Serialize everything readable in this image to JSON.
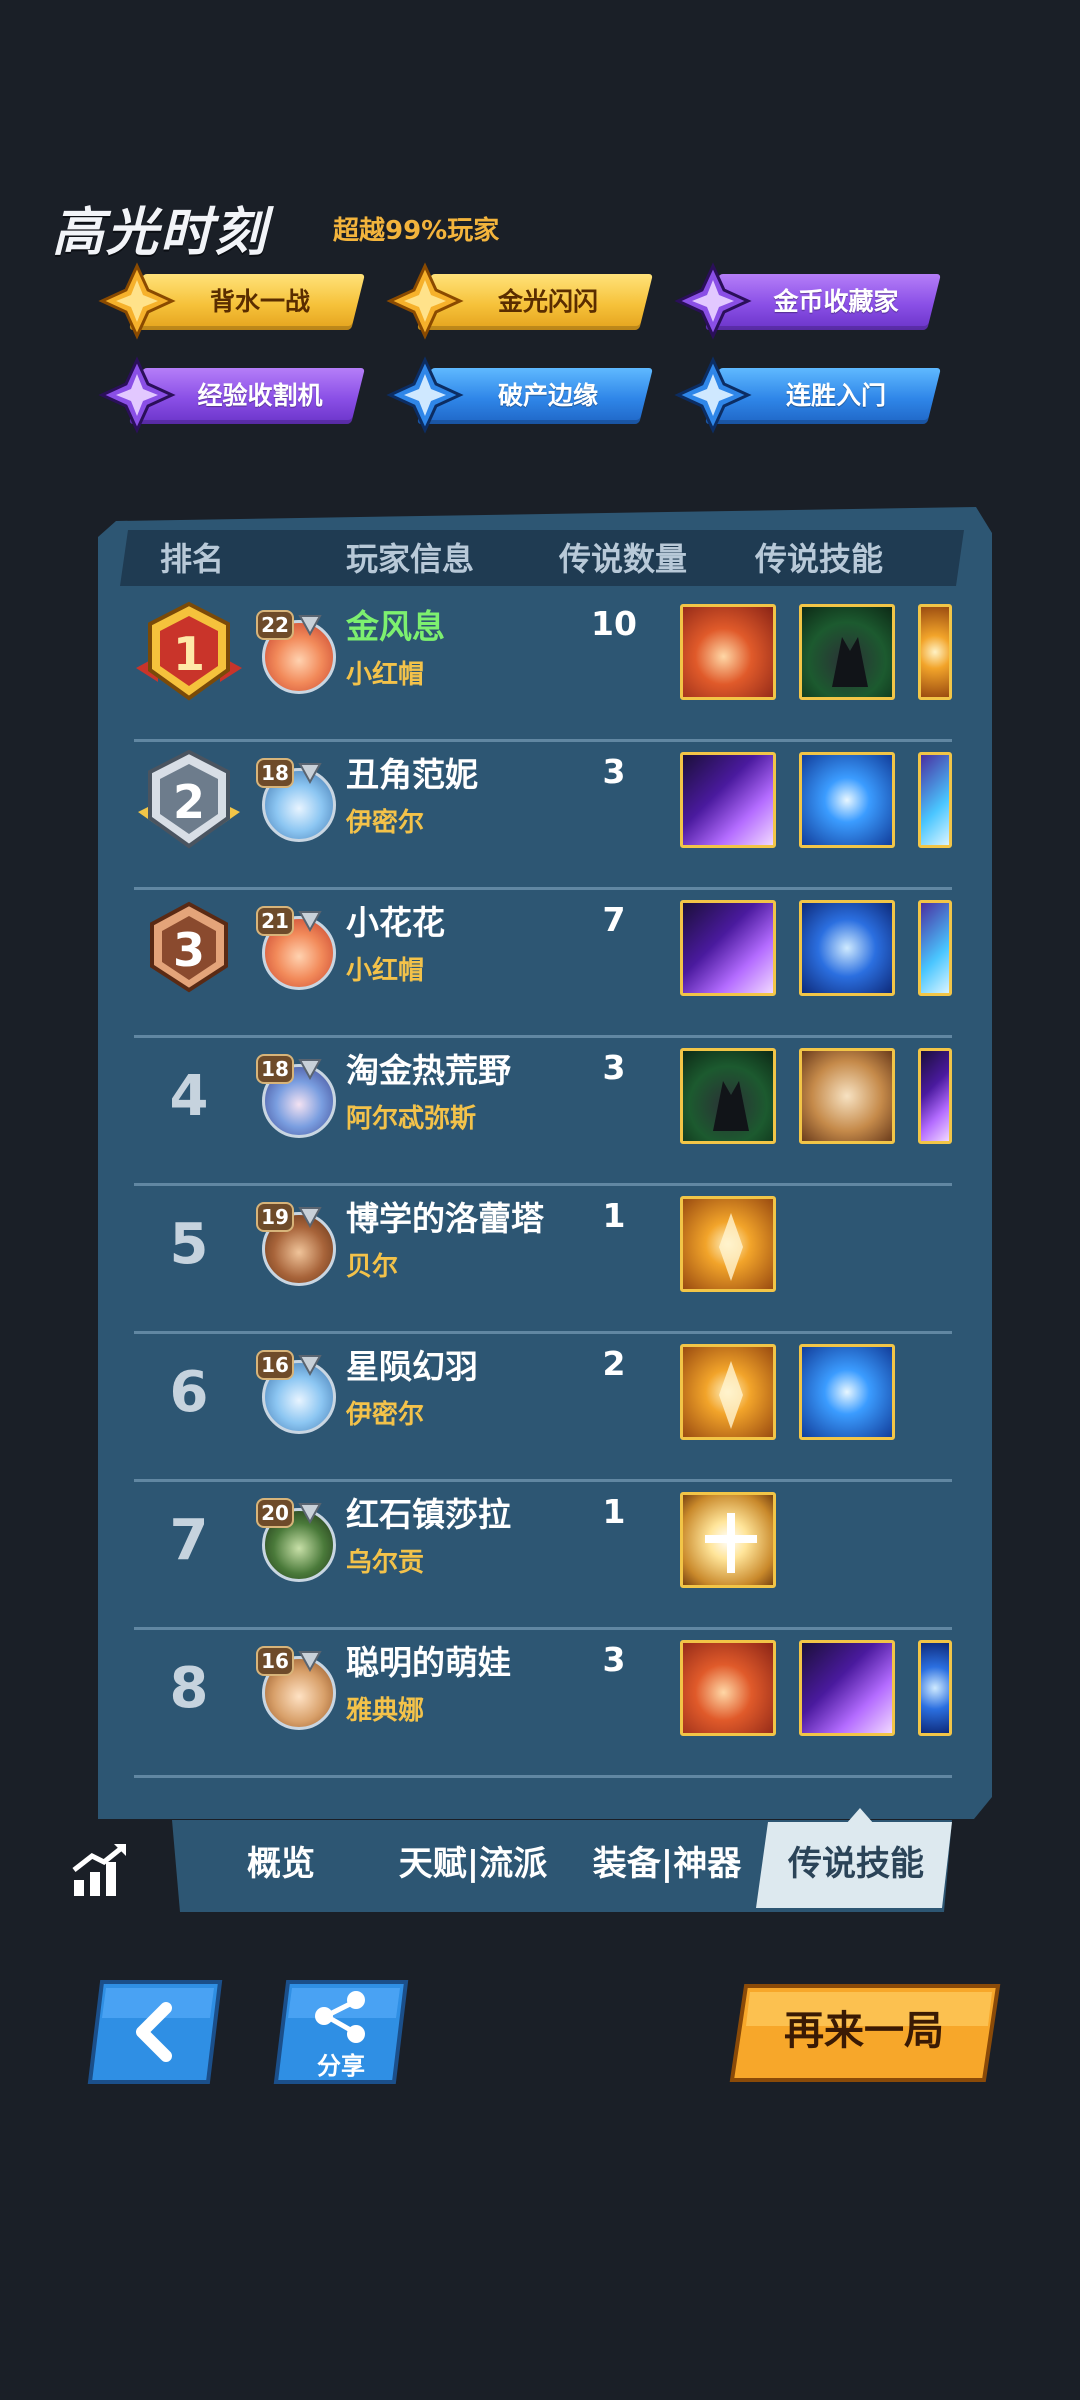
{
  "highlights": {
    "title": "高光时刻",
    "subtitle": "超越99%玩家",
    "badges": [
      {
        "label": "背水一战",
        "tier": "gold"
      },
      {
        "label": "金光闪闪",
        "tier": "gold"
      },
      {
        "label": "金币收藏家",
        "tier": "purple"
      },
      {
        "label": "经验收割机",
        "tier": "purple"
      },
      {
        "label": "破产边缘",
        "tier": "blue"
      },
      {
        "label": "连胜入门",
        "tier": "blue"
      }
    ]
  },
  "table": {
    "headers": [
      "排名",
      "玩家信息",
      "传说数量",
      "传说技能"
    ],
    "rows": [
      {
        "rank": "1",
        "level": "22",
        "name": "金风息",
        "hero": "小红帽",
        "legend_count": "10",
        "skills": [
          "orange-sword-icon",
          "dark-wolf-icon",
          "amber-compass-icon"
        ]
      },
      {
        "rank": "2",
        "level": "18",
        "name": "丑角范妮",
        "hero": "伊密尔",
        "legend_count": "3",
        "skills": [
          "purple-streak-icon",
          "blue-compass-icon",
          "cyan-crystal-icon"
        ]
      },
      {
        "rank": "3",
        "level": "21",
        "name": "小花花",
        "hero": "小红帽",
        "legend_count": "7",
        "skills": [
          "purple-streak-icon",
          "blue-swirl-icon",
          "cyan-crystal-icon"
        ]
      },
      {
        "rank": "4",
        "level": "18",
        "name": "淘金热荒野",
        "hero": "阿尔忒弥斯",
        "legend_count": "3",
        "skills": [
          "dark-wolf-icon",
          "tree-shield-icon",
          "purple-streak-icon"
        ]
      },
      {
        "rank": "5",
        "level": "19",
        "name": "博学的洛蕾塔",
        "hero": "贝尔",
        "legend_count": "1",
        "skills": [
          "amber-compass-icon"
        ]
      },
      {
        "rank": "6",
        "level": "16",
        "name": "星陨幻羽",
        "hero": "伊密尔",
        "legend_count": "2",
        "skills": [
          "amber-compass-icon",
          "blue-compass-icon"
        ]
      },
      {
        "rank": "7",
        "level": "20",
        "name": "红石镇莎拉",
        "hero": "乌尔贡",
        "legend_count": "1",
        "skills": [
          "holy-cross-icon"
        ]
      },
      {
        "rank": "8",
        "level": "16",
        "name": "聪明的萌娃",
        "hero": "雅典娜",
        "legend_count": "3",
        "skills": [
          "orange-sword-icon",
          "purple-streak-icon",
          "blue-swirl-icon"
        ]
      }
    ]
  },
  "tabs": {
    "overview": "概览",
    "talent": "天赋|流派",
    "equipment": "装备|神器",
    "legend_skills": "传说技能",
    "active": "legend_skills"
  },
  "buttons": {
    "back_icon": "chevron-left-icon",
    "share_label": "分享",
    "again_label": "再来一局"
  },
  "colors": {
    "background": "#1a1f27",
    "panel": "#2d5673",
    "name_highlight": "#7df06f",
    "hero_name": "#f3c24a",
    "accent_orange": "#f7a72a"
  }
}
